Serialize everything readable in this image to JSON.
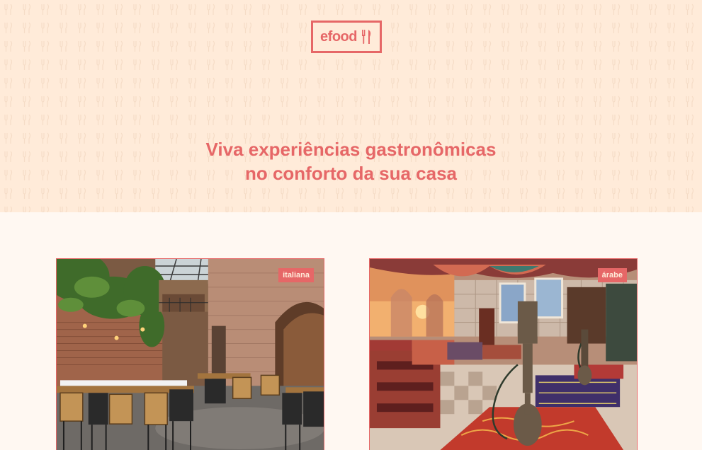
{
  "header": {
    "logo_text": "efood",
    "logo_icon": "fork-knife-icon",
    "tagline_line1": "Viva experiências gastronômicas",
    "tagline_line2": "no conforto da sua casa"
  },
  "restaurants": [
    {
      "tag": "italiana",
      "image": "italian-restaurant-interior"
    },
    {
      "tag": "árabe",
      "image": "arabic-restaurant-interior"
    }
  ],
  "colors": {
    "primary": "#E66767",
    "hero_background": "#FFEBD9",
    "page_background": "#FFF8F2"
  }
}
